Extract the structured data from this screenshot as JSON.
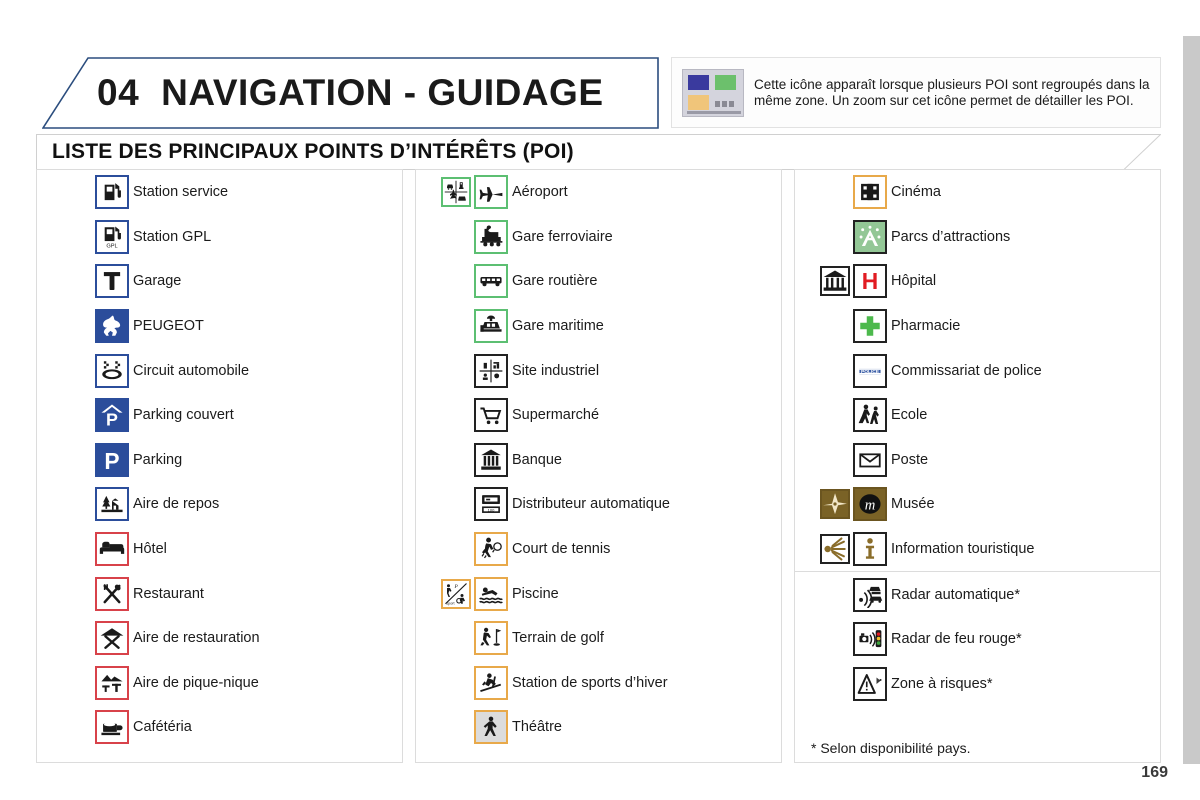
{
  "header": {
    "chapter_number": "04",
    "chapter_title": "NAVIGATION - GUIDAGE",
    "border_color": "#2b4d7e"
  },
  "info_box": {
    "icon_name": "poi-cluster-icon",
    "text": "Cette icône apparaît lorsque plusieurs POI sont regroupés dans la même zone. Un zoom sur cet icône permet de détailler les POI.",
    "colors": {
      "blue": "#3a3a9e",
      "green": "#6cc06c",
      "orange": "#f0c57a",
      "background": "#d4d4dd"
    }
  },
  "section": {
    "title": "LISTE DES PRINCIPAUX POINTS D’INTÉRÊTS (POI)"
  },
  "columns": [
    {
      "id": "column-1",
      "items": [
        {
          "label": "Station service",
          "icon": "fuel-pump-icon",
          "border": "blue"
        },
        {
          "label": "Station GPL",
          "icon": "lpg-pump-icon",
          "border": "blue"
        },
        {
          "label": "Garage",
          "icon": "wrench-icon",
          "border": "blue"
        },
        {
          "label": "PEUGEOT",
          "icon": "peugeot-lion-icon",
          "border": "blue",
          "fill": "blue"
        },
        {
          "label": "Circuit automobile",
          "icon": "race-circuit-icon",
          "border": "blue"
        },
        {
          "label": "Parking couvert",
          "icon": "covered-parking-icon",
          "border": "blue",
          "fill": "blue"
        },
        {
          "label": "Parking",
          "icon": "parking-icon",
          "border": "blue",
          "fill": "blue"
        },
        {
          "label": "Aire de repos",
          "icon": "rest-area-icon",
          "border": "blue"
        },
        {
          "label": "Hôtel",
          "icon": "hotel-bed-icon",
          "border": "red"
        },
        {
          "label": "Restaurant",
          "icon": "restaurant-icon",
          "border": "red"
        },
        {
          "label": "Aire de restauration",
          "icon": "food-area-icon",
          "border": "red"
        },
        {
          "label": "Aire de pique-nique",
          "icon": "picnic-area-icon",
          "border": "red"
        },
        {
          "label": "Cafétéria",
          "icon": "cafeteria-cup-icon",
          "border": "red"
        }
      ]
    },
    {
      "id": "column-2",
      "items": [
        {
          "label": "Aéroport",
          "icon": "airplane-icon",
          "border": "green",
          "cluster": true
        },
        {
          "label": "Gare ferroviaire",
          "icon": "train-icon",
          "border": "green"
        },
        {
          "label": "Gare routière",
          "icon": "bus-icon",
          "border": "green"
        },
        {
          "label": "Gare maritime",
          "icon": "ferry-icon",
          "border": "green"
        },
        {
          "label": "Site industriel",
          "icon": "industrial-site-icon",
          "border": "black"
        },
        {
          "label": "Supermarché",
          "icon": "shopping-cart-icon",
          "border": "black"
        },
        {
          "label": "Banque",
          "icon": "bank-icon",
          "border": "black"
        },
        {
          "label": "Distributeur automatique",
          "icon": "atm-icon",
          "border": "black"
        },
        {
          "label": "Court de tennis",
          "icon": "tennis-icon",
          "border": "orange"
        },
        {
          "label": "Piscine",
          "icon": "swimming-icon",
          "border": "orange",
          "cluster": true
        },
        {
          "label": "Terrain de golf",
          "icon": "golf-icon",
          "border": "orange"
        },
        {
          "label": "Station de sports d’hiver",
          "icon": "ski-icon",
          "border": "orange"
        },
        {
          "label": "Théâtre",
          "icon": "theatre-icon",
          "border": "orange",
          "fill": "gray"
        }
      ]
    },
    {
      "id": "column-3",
      "items": [
        {
          "label": "Cinéma",
          "icon": "film-reel-icon",
          "border": "orange"
        },
        {
          "label": "Parcs d’attractions",
          "icon": "theme-park-icon",
          "border": "black",
          "fill": "green"
        },
        {
          "label": "Hôpital",
          "icon": "hospital-h-icon",
          "border": "black",
          "cluster": true,
          "cluster_icon": "monument-icon"
        },
        {
          "label": "Pharmacie",
          "icon": "pharmacy-cross-icon",
          "border": "black"
        },
        {
          "label": "Commissariat de police",
          "icon": "police-icon",
          "border": "black"
        },
        {
          "label": "Ecole",
          "icon": "school-icon",
          "border": "black"
        },
        {
          "label": "Poste",
          "icon": "envelope-icon",
          "border": "black"
        },
        {
          "label": "Musée",
          "icon": "museum-m-icon",
          "border": "brown",
          "fill": "brown",
          "cluster": true,
          "cluster_icon": "compass-rose-icon"
        },
        {
          "label": "Information touristique",
          "icon": "info-i-icon",
          "border": "black",
          "cluster": true,
          "cluster_icon": "viewpoint-icon"
        }
      ],
      "items_secondary": [
        {
          "label": "Radar automatique*",
          "icon": "speed-camera-icon",
          "border": "black"
        },
        {
          "label": "Radar de feu rouge*",
          "icon": "red-light-camera-icon",
          "border": "black"
        },
        {
          "label": "Zone à risques*",
          "icon": "risk-zone-icon",
          "border": "black"
        }
      ],
      "footnote": "* Selon disponibilité pays."
    }
  ],
  "page_number": "169"
}
